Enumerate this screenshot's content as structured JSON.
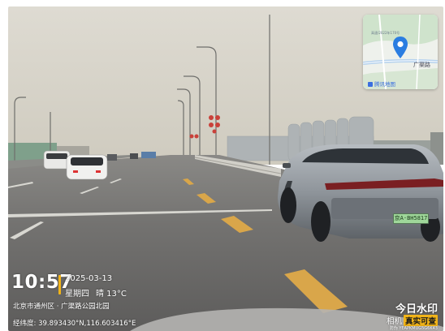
{
  "overlay": {
    "time": "10:57",
    "date": "2025-03-13",
    "weekday": "星期四",
    "weather": "晴 13°C",
    "location": "北京市通州区 · 广渠路公园北园",
    "coordinates": "经纬度: 39.893430°N,116.603416°E"
  },
  "map": {
    "road_label": "广渠路",
    "tiny_text": "高速/2022年170号",
    "provider": "腾讯地图",
    "pin_color": "#2a7de1"
  },
  "brand": {
    "name": "今日水印",
    "camera_label": "相机",
    "verified_badge": "真实可查",
    "device_id": "防伪 YEAPKMUG5G6K43"
  },
  "scene": {
    "license_plate": "京A·BH5817",
    "sky_color": "#d6d3c9",
    "road_color": "#6f6e6c",
    "lane_marking_color": "#d9a64a"
  }
}
